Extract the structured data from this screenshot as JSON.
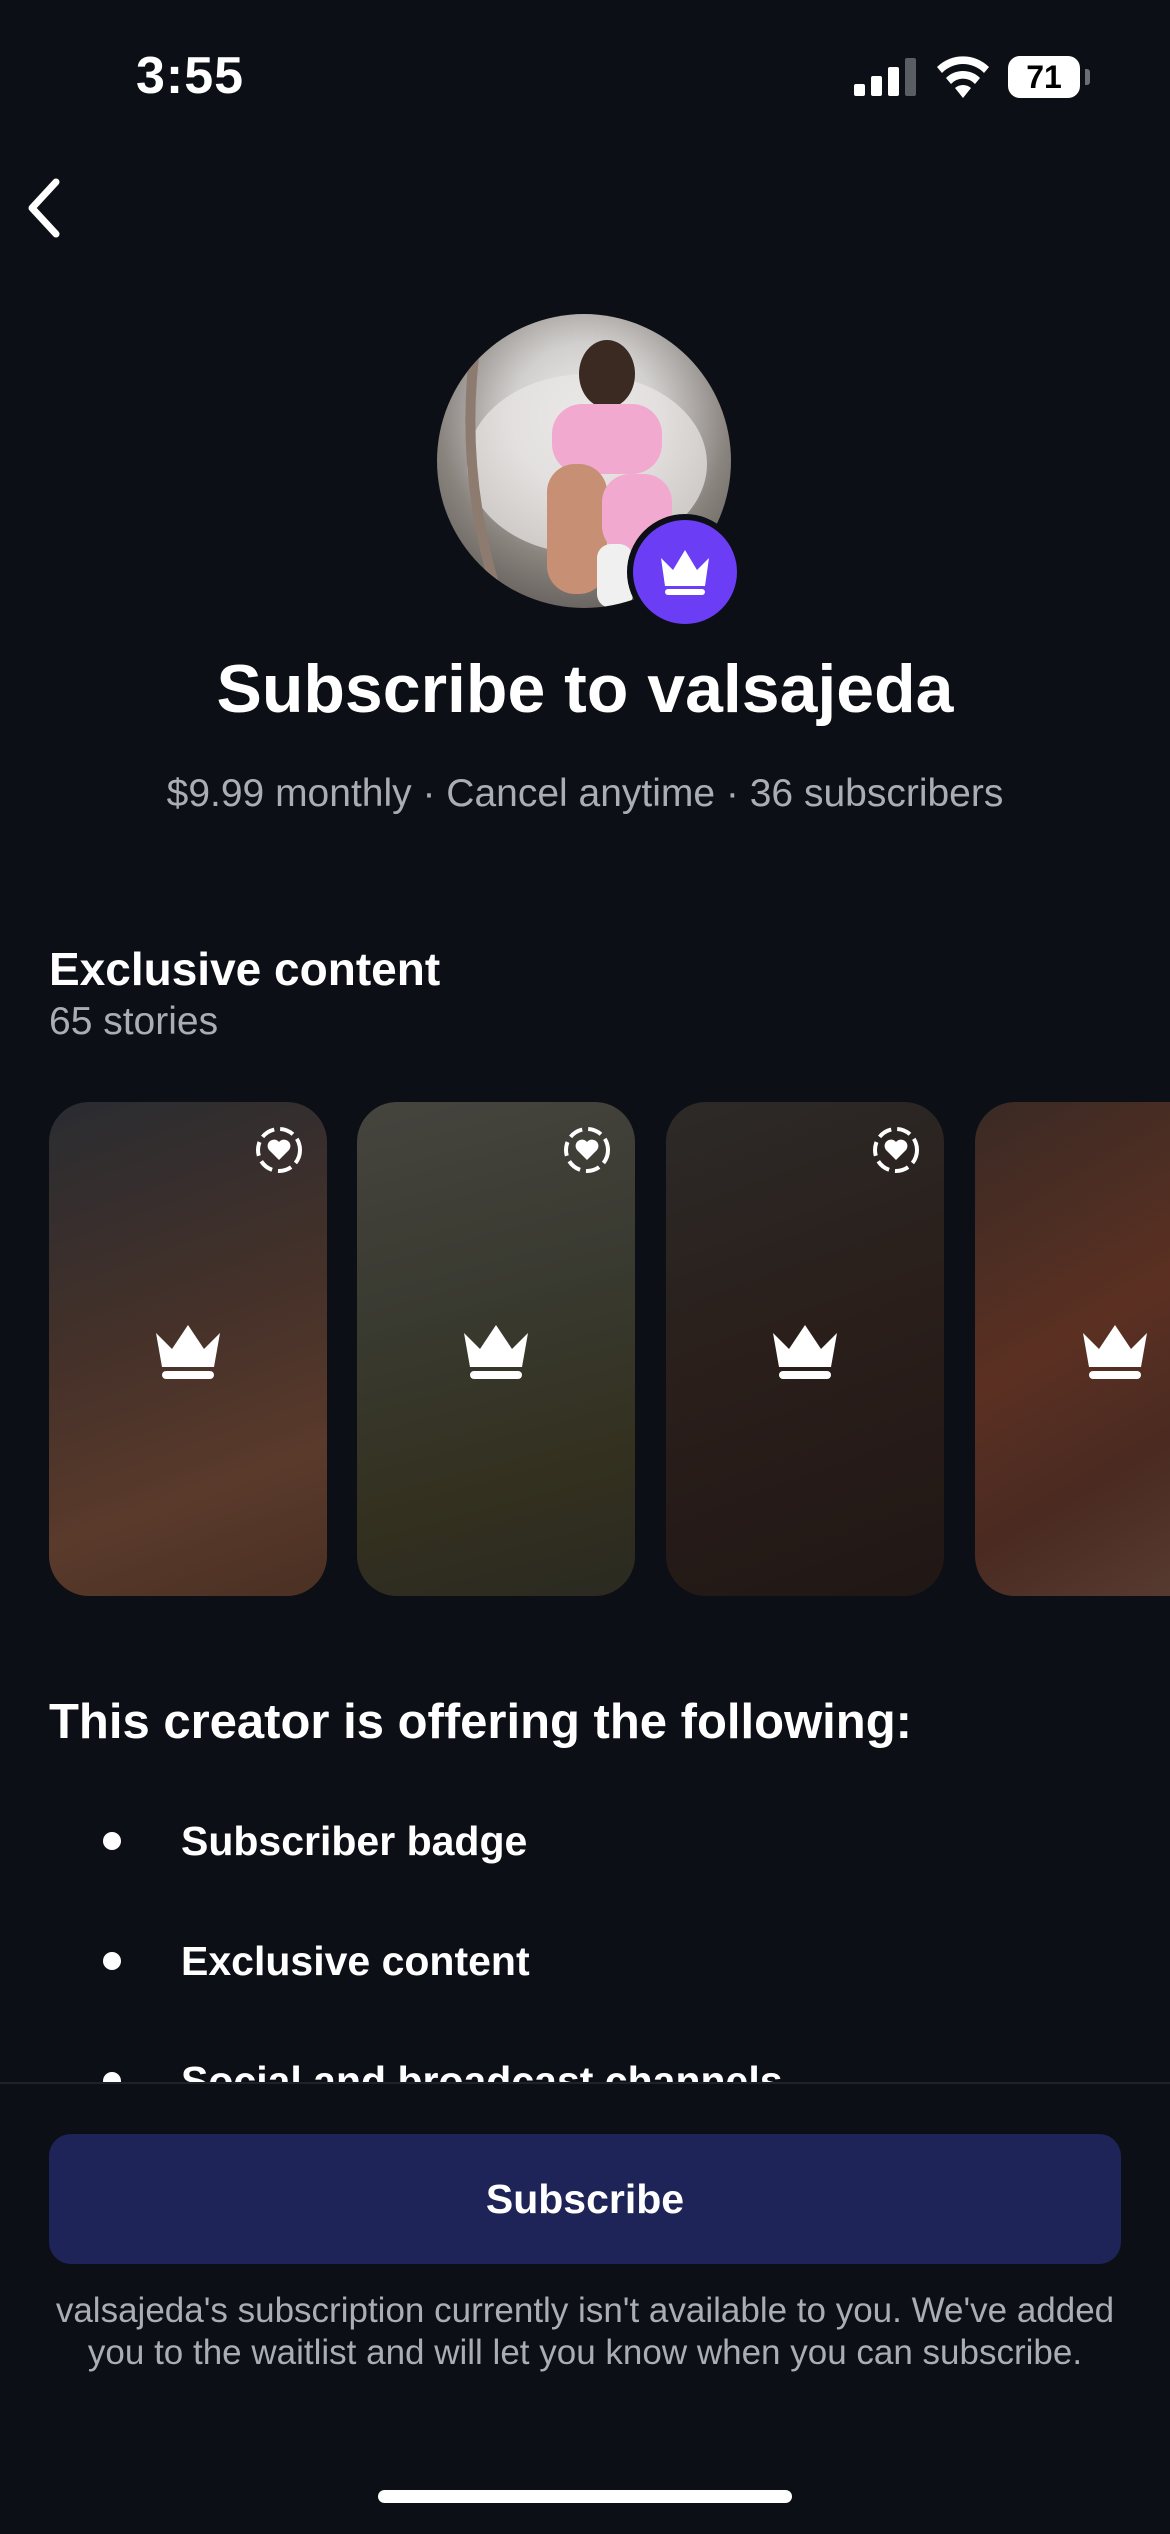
{
  "status_bar": {
    "time": "3:55",
    "battery": "71"
  },
  "profile": {
    "title": "Subscribe to valsajeda",
    "subtitle": "$9.99 monthly · Cancel anytime · 36 subscribers"
  },
  "exclusive": {
    "title": "Exclusive content",
    "count": "65 stories"
  },
  "offer": {
    "title": "This creator is offering the following:",
    "items": [
      "Subscriber badge",
      "Exclusive content",
      "Social and broadcast channels"
    ]
  },
  "footer": {
    "subscribe_label": "Subscribe",
    "note": "valsajeda's subscription currently isn't available to you. We've added you to the waitlist and will let you know when you can subscribe."
  },
  "colors": {
    "accent": "#6b3df5",
    "button": "#1f2458",
    "background": "#0c0f15",
    "muted_text": "#a8adb6"
  }
}
